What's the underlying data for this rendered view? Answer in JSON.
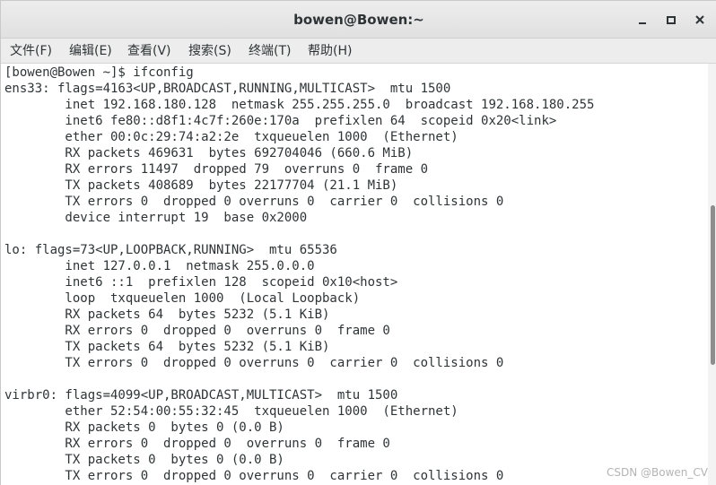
{
  "window": {
    "title": "bowen@Bowen:~"
  },
  "window_controls": [
    {
      "name": "minimize-button",
      "icon": "minimize-icon"
    },
    {
      "name": "maximize-button",
      "icon": "maximize-icon"
    },
    {
      "name": "close-button",
      "icon": "close-icon"
    }
  ],
  "menu": {
    "items": [
      "文件(F)",
      "编辑(E)",
      "查看(V)",
      "搜索(S)",
      "终端(T)",
      "帮助(H)"
    ]
  },
  "terminal": {
    "lines": [
      "[bowen@Bowen ~]$ ifconfig",
      "ens33: flags=4163<UP,BROADCAST,RUNNING,MULTICAST>  mtu 1500",
      "        inet 192.168.180.128  netmask 255.255.255.0  broadcast 192.168.180.255",
      "        inet6 fe80::d8f1:4c7f:260e:170a  prefixlen 64  scopeid 0x20<link>",
      "        ether 00:0c:29:74:a2:2e  txqueuelen 1000  (Ethernet)",
      "        RX packets 469631  bytes 692704046 (660.6 MiB)",
      "        RX errors 11497  dropped 79  overruns 0  frame 0",
      "        TX packets 408689  bytes 22177704 (21.1 MiB)",
      "        TX errors 0  dropped 0 overruns 0  carrier 0  collisions 0",
      "        device interrupt 19  base 0x2000",
      "",
      "lo: flags=73<UP,LOOPBACK,RUNNING>  mtu 65536",
      "        inet 127.0.0.1  netmask 255.0.0.0",
      "        inet6 ::1  prefixlen 128  scopeid 0x10<host>",
      "        loop  txqueuelen 1000  (Local Loopback)",
      "        RX packets 64  bytes 5232 (5.1 KiB)",
      "        RX errors 0  dropped 0  overruns 0  frame 0",
      "        TX packets 64  bytes 5232 (5.1 KiB)",
      "        TX errors 0  dropped 0 overruns 0  carrier 0  collisions 0",
      "",
      "virbr0: flags=4099<UP,BROADCAST,MULTICAST>  mtu 1500",
      "        ether 52:54:00:55:32:45  txqueuelen 1000  (Ethernet)",
      "        RX packets 0  bytes 0 (0.0 B)",
      "        RX errors 0  dropped 0  overruns 0  frame 0",
      "        TX packets 0  bytes 0 (0.0 B)",
      "        TX errors 0  dropped 0 overruns 0  carrier 0  collisions 0"
    ]
  },
  "watermark": "CSDN @Bowen_CV",
  "colors": {
    "titlebar": "#e6e6e6",
    "terminal_background": "#ffffff",
    "terminal_text": "#2e3436"
  }
}
